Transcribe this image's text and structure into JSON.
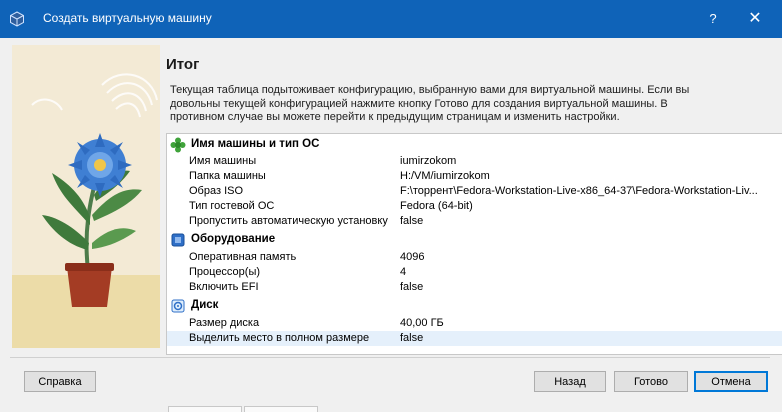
{
  "window": {
    "title": "Создать виртуальную машину",
    "help_label": "?",
    "close_label": "✕",
    "titlebar_color": "#0f63b8"
  },
  "page": {
    "heading": "Итог",
    "description_lines": [
      "Текущая таблица подытоживает конфигурацию, выбранную вами для виртуальной машины. Если вы",
      "довольны текущей конфигурацией нажмите кнопку Готово для создания виртуальной машины. В",
      "противном случае вы можете перейти к предыдущим страницам и изменить настройки."
    ]
  },
  "summary": {
    "sections": [
      {
        "title": "Имя машины и тип ОС",
        "icon": "puzzle-icon",
        "rows": [
          {
            "key": "Имя машины",
            "value": "iumirzokom"
          },
          {
            "key": "Папка машины",
            "value": "H:/VM/iumirzokom"
          },
          {
            "key": "Образ ISO",
            "value": "F:\\торрент\\Fedora-Workstation-Live-x86_64-37\\Fedora-Workstation-Liv..."
          },
          {
            "key": "Тип гостевой ОС",
            "value": "Fedora (64-bit)"
          },
          {
            "key": "Пропустить автоматическую установку",
            "value": "false"
          }
        ]
      },
      {
        "title": "Оборудование",
        "icon": "chip-icon",
        "rows": [
          {
            "key": "Оперативная память",
            "value": "4096"
          },
          {
            "key": "Процессор(ы)",
            "value": "4"
          },
          {
            "key": "Включить EFI",
            "value": "false"
          }
        ]
      },
      {
        "title": "Диск",
        "icon": "disk-icon",
        "rows": [
          {
            "key": "Размер диска",
            "value": "40,00 ГБ"
          },
          {
            "key": "Выделить место в полном размере",
            "value": "false"
          }
        ]
      }
    ]
  },
  "buttons": {
    "help": "Справка",
    "back": "Назад",
    "finish": "Готово",
    "cancel": "Отмена"
  }
}
